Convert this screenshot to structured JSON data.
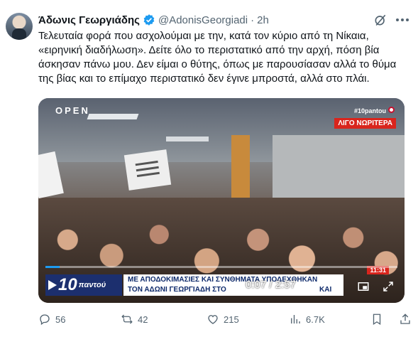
{
  "author": {
    "display_name": "Άδωνις Γεωργιάδης",
    "handle": "@AdonisGeorgiadi",
    "separator": "·",
    "time": "2h"
  },
  "tweet": {
    "text": "Τελευταία φορά που ασχολούμαι με την, κατά τον κύριο από τη Νίκαια,\n«ειρηνική διαδήλωση». Δείτε όλο το περιστατικό από την αρχή, πόση βία\nάσκησαν πάνω μου. Δεν είμαι ο θύτης, όπως με παρουσίασαν αλλά το θύμα\nτης βίας και το επίμαχο περιστατικό δεν έγινε μπροστά, αλλά στο πλάι."
  },
  "video": {
    "logo": "OPEN",
    "hashtag": "#10pantou",
    "badge": "ΛΙΓΟ ΝΩΡΙΤΕΡΑ",
    "channel_number": "10",
    "channel_name": "παντού",
    "headline_line1": "ΜΕ ΑΠΟΔΟΚΙΜΑΣΙΕΣ ΚΑΙ ΣΥΝΘΗΜΑΤΑ ΥΠΟΔΕΧΘΗΚΑΝ",
    "headline_line2": "ΤΟΝ ΑΔΩΝΙ ΓΕΩΡΓΙΑΔΗ ΣΤΟ",
    "headline_line2_tail": "ΚΑΙ",
    "clock": "11:31",
    "time_display": "0:07 / 2:57",
    "progress": 0.04
  },
  "actions": {
    "replies": "56",
    "retweets": "42",
    "likes": "215",
    "views": "6.7K"
  },
  "colors": {
    "accent": "#1d9bf0",
    "muted": "#536471",
    "badge_red": "#d9251d",
    "channel_blue": "#1c2f6e"
  },
  "icons": {
    "verified": "verified-badge-icon",
    "grok": "grok-icon",
    "more": "more-icon",
    "reply": "reply-icon",
    "retweet": "retweet-icon",
    "like": "heart-icon",
    "views": "views-icon",
    "bookmark": "bookmark-icon",
    "share": "share-icon"
  }
}
